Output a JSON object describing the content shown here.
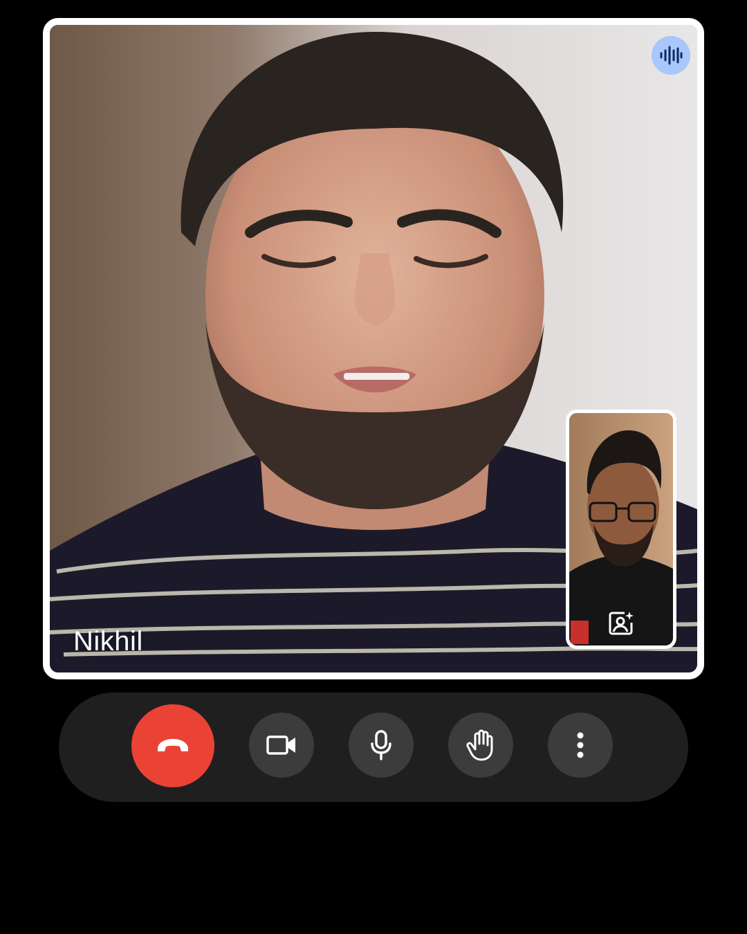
{
  "call": {
    "remote_participant": {
      "name": "Nikhil"
    },
    "speaking_indicator_icon": "audio-waveform-icon",
    "self_view": {
      "effects_icon": "person-effects-icon"
    }
  },
  "controls": [
    {
      "icon": "end-call-icon",
      "color": "#ea4335"
    },
    {
      "icon": "camera-icon"
    },
    {
      "icon": "microphone-icon"
    },
    {
      "icon": "raise-hand-icon"
    },
    {
      "icon": "more-vert-icon"
    }
  ],
  "colors": {
    "background": "#000000",
    "control_bar": "#1f1f1f",
    "control_button": "#3c3c3c",
    "end_call": "#ea4335",
    "speaking_badge": "#a8c7fa"
  }
}
